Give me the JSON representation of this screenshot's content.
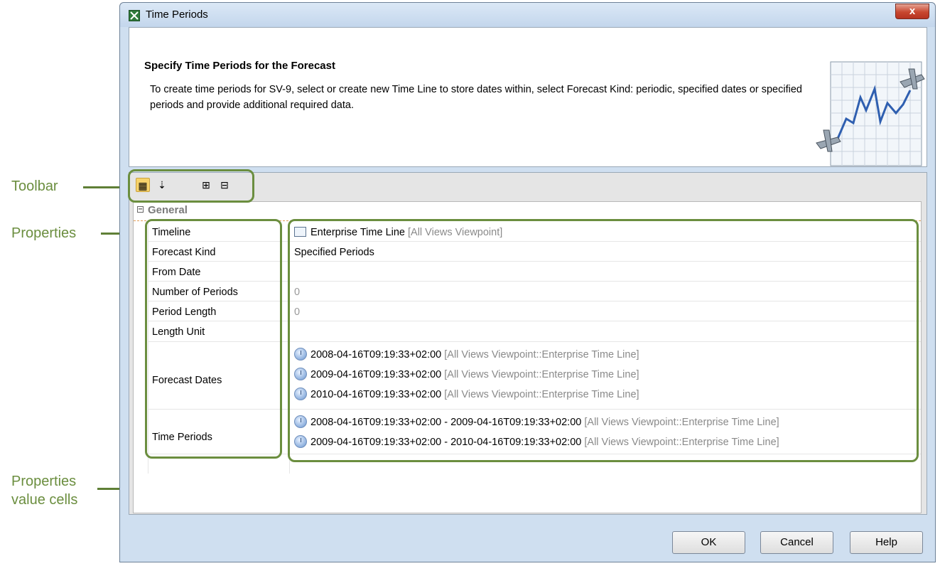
{
  "callouts": {
    "toolbar": "Toolbar",
    "properties": "Properties",
    "value_cells_line1": "Properties",
    "value_cells_line2": "value cells"
  },
  "window": {
    "title": "Time Periods",
    "close": "x"
  },
  "header": {
    "heading": "Specify Time Periods for the Forecast",
    "description": "To create time periods for SV-9, select or create new Time Line to store dates within, select Forecast Kind: periodic, specified dates or specified periods and provide additional required data."
  },
  "toolbar": {
    "icons": [
      "categorized-view-icon",
      "sort-alphabetically-icon",
      "expand-all-icon",
      "collapse-all-icon"
    ]
  },
  "group": {
    "label": "General",
    "expander": "−"
  },
  "properties": {
    "timeline": {
      "name": "Timeline",
      "value": "Enterprise Time Line",
      "context": "[All Views Viewpoint]"
    },
    "forecast_kind": {
      "name": "Forecast Kind",
      "value": "Specified Periods"
    },
    "from_date": {
      "name": "From Date",
      "value": ""
    },
    "number_of_periods": {
      "name": "Number of Periods",
      "value": "0"
    },
    "period_length": {
      "name": "Period Length",
      "value": "0"
    },
    "length_unit": {
      "name": "Length Unit",
      "value": ""
    },
    "forecast_dates": {
      "name": "Forecast Dates",
      "values": [
        {
          "date": "2008-04-16T09:19:33+02:00",
          "context": "[All Views Viewpoint::Enterprise Time Line]"
        },
        {
          "date": "2009-04-16T09:19:33+02:00",
          "context": "[All Views Viewpoint::Enterprise Time Line]"
        },
        {
          "date": "2010-04-16T09:19:33+02:00",
          "context": "[All Views Viewpoint::Enterprise Time Line]"
        }
      ]
    },
    "time_periods": {
      "name": "Time Periods",
      "values": [
        {
          "period": "2008-04-16T09:19:33+02:00 - 2009-04-16T09:19:33+02:00",
          "context": "[All Views Viewpoint::Enterprise Time Line]"
        },
        {
          "period": "2009-04-16T09:19:33+02:00 - 2010-04-16T09:19:33+02:00",
          "context": "[All Views Viewpoint::Enterprise Time Line]"
        }
      ]
    }
  },
  "buttons": {
    "ok": "OK",
    "cancel": "Cancel",
    "help": "Help"
  },
  "colors": {
    "callout_green": "#6b8e3f",
    "window_frame": "#cfdff0",
    "close_red": "#c8472f",
    "active_tool": "#f7d36b"
  }
}
